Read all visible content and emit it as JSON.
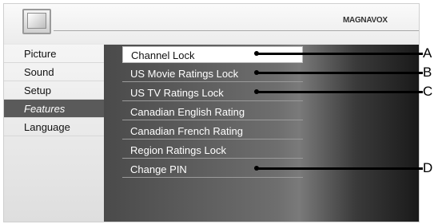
{
  "header": {
    "brand": "MAGNAVOX",
    "icon": "tv-icon"
  },
  "left_menu": {
    "items": [
      {
        "label": "Picture",
        "active": false
      },
      {
        "label": "Sound",
        "active": false
      },
      {
        "label": "Setup",
        "active": false
      },
      {
        "label": "Features",
        "active": true
      },
      {
        "label": "Language",
        "active": false
      }
    ]
  },
  "features_menu": {
    "items": [
      {
        "label": "Channel Lock",
        "selected": true
      },
      {
        "label": "US Movie Ratings Lock",
        "selected": false
      },
      {
        "label": "US TV Ratings Lock",
        "selected": false
      },
      {
        "label": "Canadian English Rating",
        "selected": false
      },
      {
        "label": "Canadian French Rating",
        "selected": false
      },
      {
        "label": "Region Ratings Lock",
        "selected": false
      },
      {
        "label": "Change PIN",
        "selected": false
      }
    ]
  },
  "callouts": [
    "A",
    "B",
    "C",
    "D"
  ],
  "colors": {
    "active_item_bg": "#5a5a5a",
    "panel_dark": "#4a4a4a",
    "selected_bg": "#ffffff"
  }
}
